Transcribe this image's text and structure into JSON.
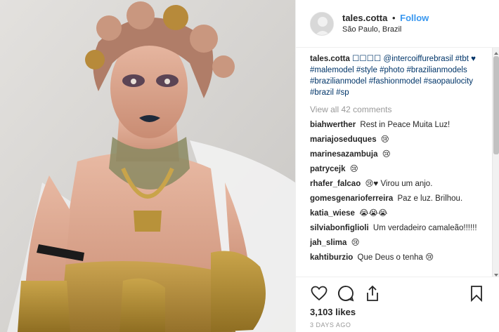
{
  "post": {
    "username": "tales.cotta",
    "separator": "•",
    "follow_label": "Follow",
    "location": "São Paulo, Brazil",
    "photo_alt": "photo"
  },
  "caption": {
    "username": "tales.cotta",
    "text": "☐☐☐☐ @intercoiffurebrasil #tbt ♥ #malemodel #style #photo #brazilianmodels #brazilianmodel #fashionmodel #saopaulocity #brazil #sp"
  },
  "view_all_label": "View all 42 comments",
  "comments": [
    {
      "user": "biahwerther",
      "text": "Rest in Peace Muita Luz!"
    },
    {
      "user": "mariajoseduques",
      "text": "😢"
    },
    {
      "user": "marinesazambuja",
      "text": "😢"
    },
    {
      "user": "patrycejk",
      "text": "😢"
    },
    {
      "user": "rhafer_falcao",
      "text": "😢♥ Virou um anjo."
    },
    {
      "user": "gomesgenarioferreira",
      "text": "Paz e luz. Brilhou."
    },
    {
      "user": "katia_wiese",
      "text": "😭😭😭"
    },
    {
      "user": "silviabonfiglioli",
      "text": "Um verdadeiro camaleão!!!!!!"
    },
    {
      "user": "jah_slima",
      "text": "😢"
    },
    {
      "user": "kahtiburzio",
      "text": "Que Deus o tenha 😢"
    }
  ],
  "actions": {
    "like_icon": "heart-icon",
    "comment_icon": "comment-icon",
    "share_icon": "share-icon",
    "save_icon": "bookmark-icon"
  },
  "likes_label": "3,103 likes",
  "date_label": "3 DAYS AGO",
  "colors": {
    "link": "#3897f0",
    "hashtag": "#003569",
    "muted": "#999999",
    "text": "#262626"
  }
}
